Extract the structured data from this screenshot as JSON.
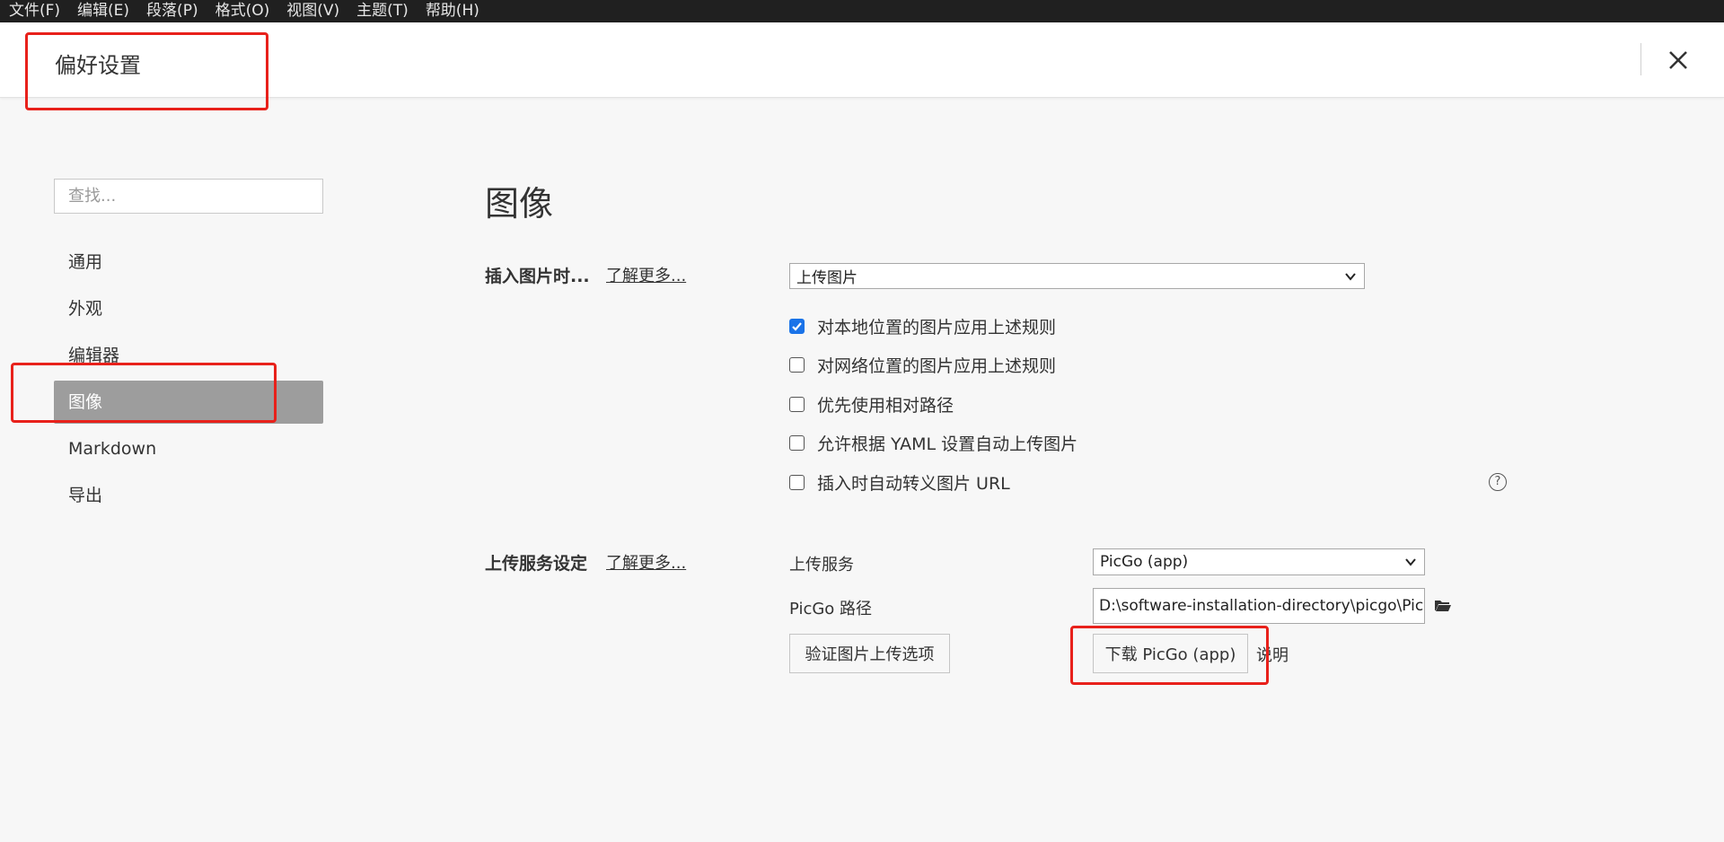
{
  "menubar": {
    "items": [
      "文件(F)",
      "编辑(E)",
      "段落(P)",
      "格式(O)",
      "视图(V)",
      "主题(T)",
      "帮助(H)"
    ]
  },
  "header": {
    "title": "偏好设置",
    "close_icon": "close-icon"
  },
  "sidebar": {
    "search_placeholder": "查找...",
    "items": [
      {
        "label": "通用",
        "active": false
      },
      {
        "label": "外观",
        "active": false
      },
      {
        "label": "编辑器",
        "active": false
      },
      {
        "label": "图像",
        "active": true
      },
      {
        "label": "Markdown",
        "active": false
      },
      {
        "label": "导出",
        "active": false
      }
    ]
  },
  "main": {
    "heading": "图像",
    "insert_section": {
      "label": "插入图片时...",
      "learn_more": "了解更多...",
      "select_value": "上传图片",
      "options": [
        {
          "label": "对本地位置的图片应用上述规则",
          "checked": true
        },
        {
          "label": "对网络位置的图片应用上述规则",
          "checked": false
        },
        {
          "label": "优先使用相对路径",
          "checked": false
        },
        {
          "label": "允许根据 YAML 设置自动上传图片",
          "checked": false
        },
        {
          "label": "插入时自动转义图片 URL",
          "checked": false
        }
      ],
      "help_icon": "?"
    },
    "upload_section": {
      "label": "上传服务设定",
      "learn_more": "了解更多...",
      "service_label": "上传服务",
      "service_value": "PicGo (app)",
      "path_label": "PicGo 路径",
      "path_value": "D:\\software-installation-directory\\picgo\\PicGo",
      "verify_button": "验证图片上传选项",
      "download_button": "下载 PicGo (app)",
      "explain_link": "说明"
    }
  },
  "colors": {
    "annotation": "#e8211b",
    "active_nav": "#9d9d9d",
    "checkbox_checked": "#1a73e8",
    "menubar_bg": "#202020"
  }
}
